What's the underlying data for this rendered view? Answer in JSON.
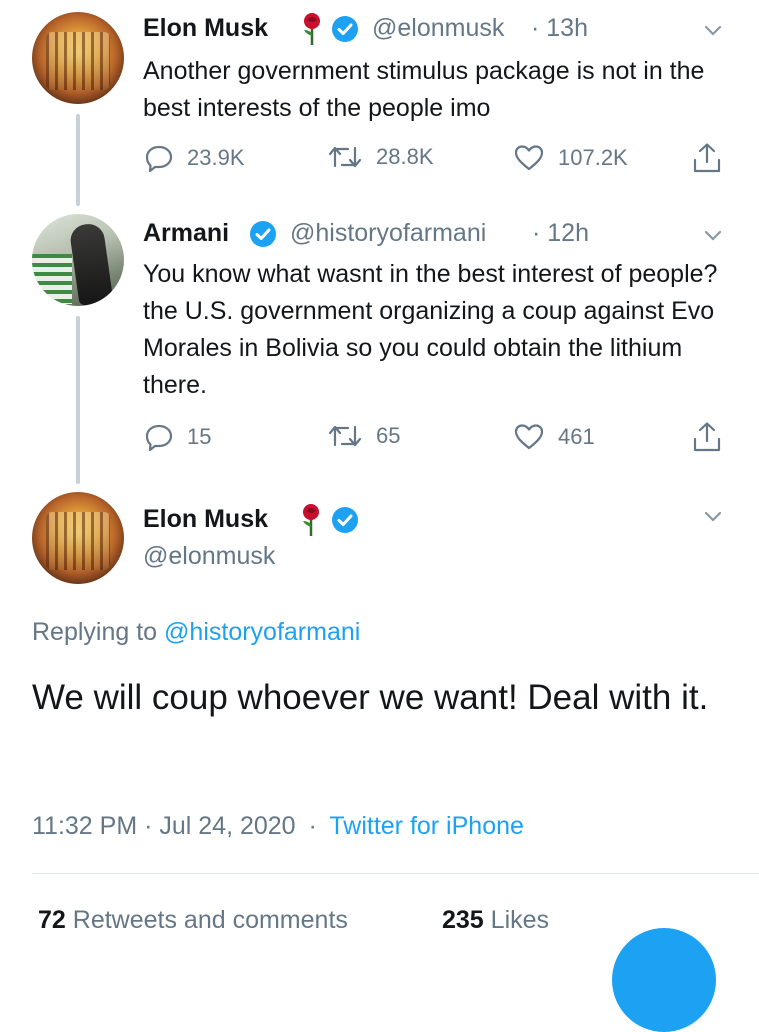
{
  "tweets": [
    {
      "name": "Elon Musk",
      "handle": "@elonmusk",
      "time": "· 13h",
      "text": "Another government stimulus package is not in the best interests of the people imo",
      "replies": "23.9K",
      "retweets": "28.8K",
      "likes": "107.2K"
    },
    {
      "name": "Armani",
      "handle": "@historyofarmani",
      "time": "· 12h",
      "text": "You know what wasnt in the best interest of people? the U.S. government organizing a coup against Evo Morales in Bolivia so you could obtain the lithium there.",
      "replies": "15",
      "retweets": "65",
      "likes": "461"
    }
  ],
  "main_tweet": {
    "name": "Elon Musk",
    "handle": "@elonmusk",
    "replying_prefix": "Replying to",
    "replying_to": "@historyofarmani",
    "text": "We will coup whoever we want! Deal with it.",
    "timestamp": "11:32 PM · Jul 24, 2020",
    "sep": "·",
    "source": "Twitter for iPhone",
    "retweets_count": "72",
    "retweets_label": "Retweets and comments",
    "likes_count": "235",
    "likes_label": "Likes"
  },
  "icons": {
    "reply": "reply-icon",
    "retweet": "retweet-icon",
    "like": "heart-icon",
    "share": "share-icon",
    "verified": "verified-badge-icon",
    "rose": "rose-emoji-icon",
    "chevron": "chevron-down-icon"
  },
  "colors": {
    "accent": "#1da1f2",
    "secondary_text": "#657786",
    "primary_text": "#14171a",
    "rose": "#c8102e"
  }
}
